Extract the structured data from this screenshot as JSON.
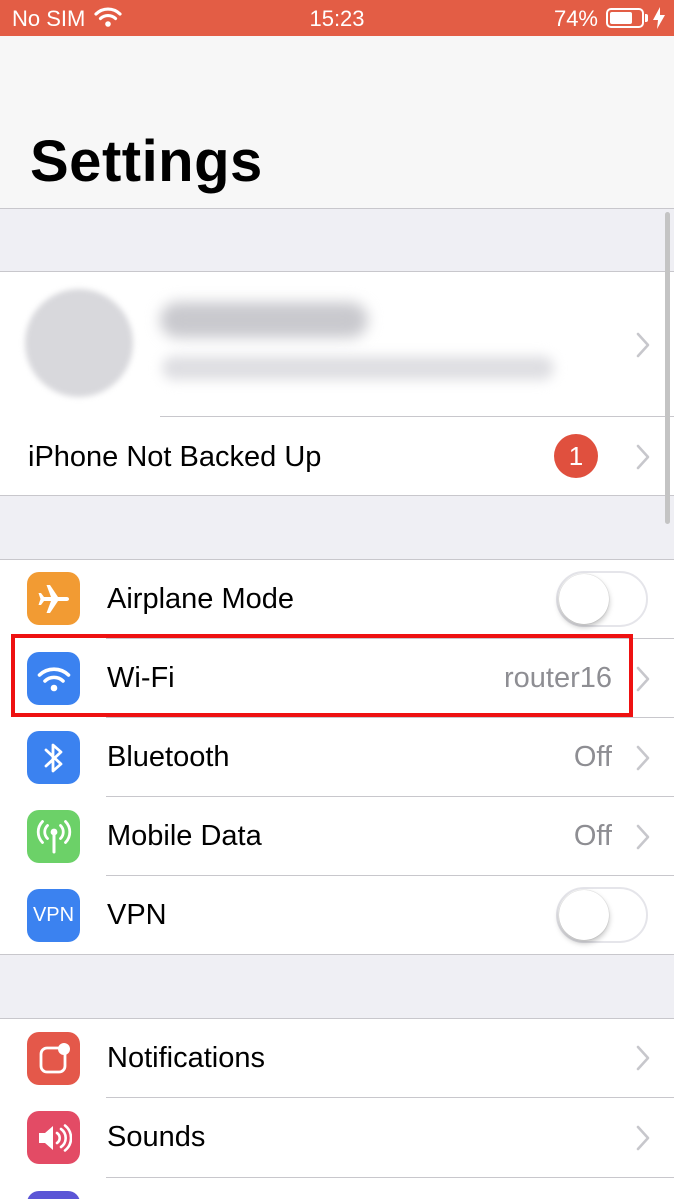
{
  "status_bar": {
    "carrier": "No SIM",
    "time": "15:23",
    "battery_percent": "74%",
    "battery_level": 0.74
  },
  "header": {
    "title": "Settings"
  },
  "account": {
    "backup_label": "iPhone Not Backed Up",
    "backup_badge": "1"
  },
  "network": {
    "airplane_mode": {
      "label": "Airplane Mode",
      "on": false
    },
    "wifi": {
      "label": "Wi-Fi",
      "value": "router16"
    },
    "bluetooth": {
      "label": "Bluetooth",
      "value": "Off"
    },
    "mobile_data": {
      "label": "Mobile Data",
      "value": "Off"
    },
    "vpn": {
      "label": "VPN",
      "icon_text": "VPN",
      "on": false
    }
  },
  "general": {
    "notifications": {
      "label": "Notifications"
    },
    "sounds": {
      "label": "Sounds"
    }
  },
  "colors": {
    "status_bar": "#e35d45",
    "airplane_icon": "#f29b33",
    "wifi_icon": "#3b82f0",
    "bluetooth_icon": "#3b82f0",
    "mobile_data_icon": "#6cd168",
    "vpn_icon": "#3b82f0",
    "notifications_icon": "#e4584a",
    "sounds_icon": "#e34b65",
    "highlight": "#ee1111"
  }
}
